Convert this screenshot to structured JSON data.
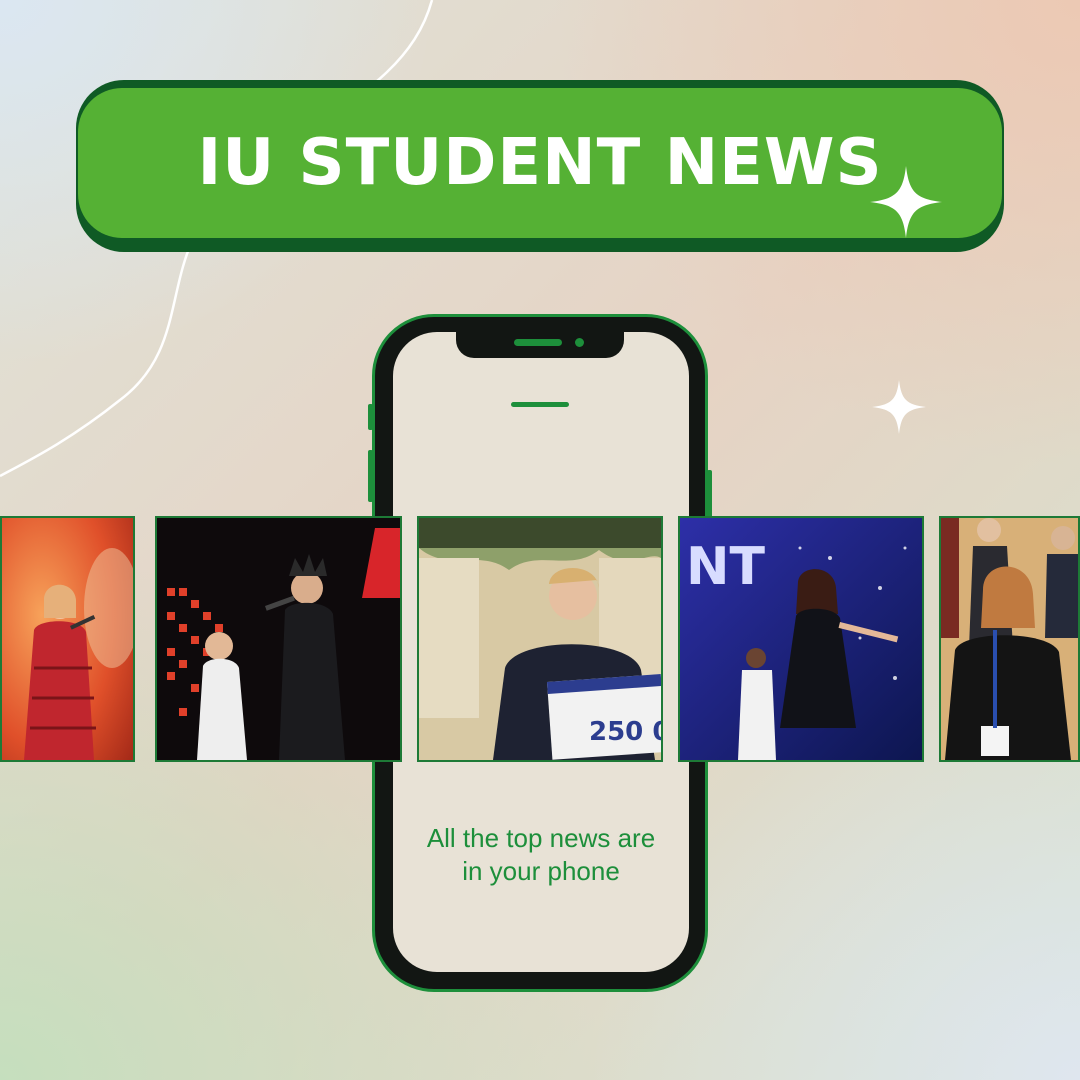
{
  "header": {
    "title": "IU STUDENT NEWS"
  },
  "phone": {
    "caption_line1": "All the top news are",
    "caption_line2": "in your phone"
  },
  "photos": [
    {
      "name": "singer-red-dress-photo"
    },
    {
      "name": "rock-band-stage-photo"
    },
    {
      "name": "student-with-prize-check-photo",
      "check_amount": "250 0"
    },
    {
      "name": "singer-blue-stage-photo",
      "screen_text": "NT"
    },
    {
      "name": "students-in-auditorium-photo"
    }
  ],
  "colors": {
    "accent": "#55b134",
    "dark_green": "#0f5a25",
    "phone_green": "#1d8f3b"
  }
}
